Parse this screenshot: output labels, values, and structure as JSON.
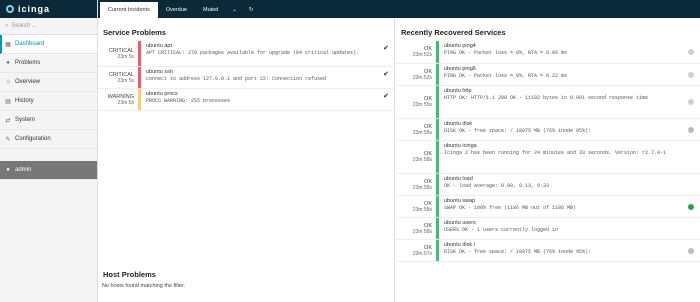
{
  "app": {
    "logo_text": "icinga"
  },
  "colors": {
    "critical": "#ff5566",
    "warning": "#ffcc66",
    "ok": "#44bb77",
    "nav_bg": "#0a2a3a",
    "accent": "#0095bf"
  },
  "sidebar": {
    "search_placeholder": "Search ...",
    "items": [
      {
        "label": "Dashboard",
        "icon": "dashboard-icon"
      },
      {
        "label": "Problems",
        "icon": "problems-icon"
      },
      {
        "label": "Overview",
        "icon": "overview-icon"
      },
      {
        "label": "History",
        "icon": "history-icon"
      },
      {
        "label": "System",
        "icon": "system-icon"
      },
      {
        "label": "Configuration",
        "icon": "wrench-icon"
      },
      {
        "label": "admin",
        "icon": "user-icon"
      }
    ]
  },
  "tabs": [
    {
      "label": "Current Incidents"
    },
    {
      "label": "Overdue"
    },
    {
      "label": "Muted"
    }
  ],
  "service_problems": {
    "title": "Service Problems",
    "rows": [
      {
        "state": "CRITICAL",
        "since": "23m 5s",
        "host": "ubuntu apt",
        "output": "APT CRITICAL: 270 packages available for upgrade (84 critical updates).",
        "color": "critical"
      },
      {
        "state": "CRITICAL",
        "since": "23m 5s",
        "host": "ubuntu ssh",
        "output": "connect to address 127.0.0.1 and port 22: Connection refused",
        "color": "critical"
      },
      {
        "state": "WARNING",
        "since": "23m 5s",
        "host": "ubuntu procs",
        "output": "PROCS WARNING: 255 processes",
        "color": "warning"
      }
    ]
  },
  "host_problems": {
    "title": "Host Problems",
    "empty": "No hosts found matching the filter."
  },
  "recovered": {
    "title": "Recently Recovered Services",
    "rows": [
      {
        "state": "OK",
        "since": "23m 52s",
        "host": "ubuntu ping4",
        "output": "PING OK - Packet loss = 0%, RTA = 0.06 ms",
        "dot": "#d8c8d8"
      },
      {
        "state": "OK",
        "since": "23m 52s",
        "host": "ubuntu ping6",
        "output": "PING OK - Packet loss = 0%, RTA = 0.22 ms",
        "dot": "#d8c8d8"
      },
      {
        "state": "OK",
        "since": "23m 55s",
        "host": "ubuntu http",
        "output": "HTTP OK: HTTP/1.1 200 OK - 11192 bytes in 0.001 second response time",
        "dot": "#d8c8d8"
      },
      {
        "state": "OK",
        "since": "23m 58s",
        "host": "ubuntu disk",
        "output": "DISK OK - free space: / 18975 MB (76% inode 95%):",
        "dot": "#bbbbbb"
      },
      {
        "state": "OK",
        "since": "23m 58s",
        "host": "ubuntu icinga",
        "output": "Icinga 2 has been running for 24 minutes and 33 seconds. Version: r2.7.0-1",
        "dot": ""
      },
      {
        "state": "OK",
        "since": "23m 58s",
        "host": "ubuntu load",
        "output": "OK - load average: 0.00, 0.13, 0.33",
        "dot": ""
      },
      {
        "state": "OK",
        "since": "23m 58s",
        "host": "ubuntu swap",
        "output": "SWAP OK - 100% free (1186 MB out of 1186 MB)",
        "dot": "#22aa44"
      },
      {
        "state": "OK",
        "since": "23m 58s",
        "host": "ubuntu users",
        "output": "USERS OK - 1 users currently logged in",
        "dot": ""
      },
      {
        "state": "OK",
        "since": "23m 57s",
        "host": "ubuntu disk /",
        "output": "DISK OK - free space: / 18975 MB (76% inode 95%):",
        "dot": "#bbbbbb"
      }
    ]
  }
}
